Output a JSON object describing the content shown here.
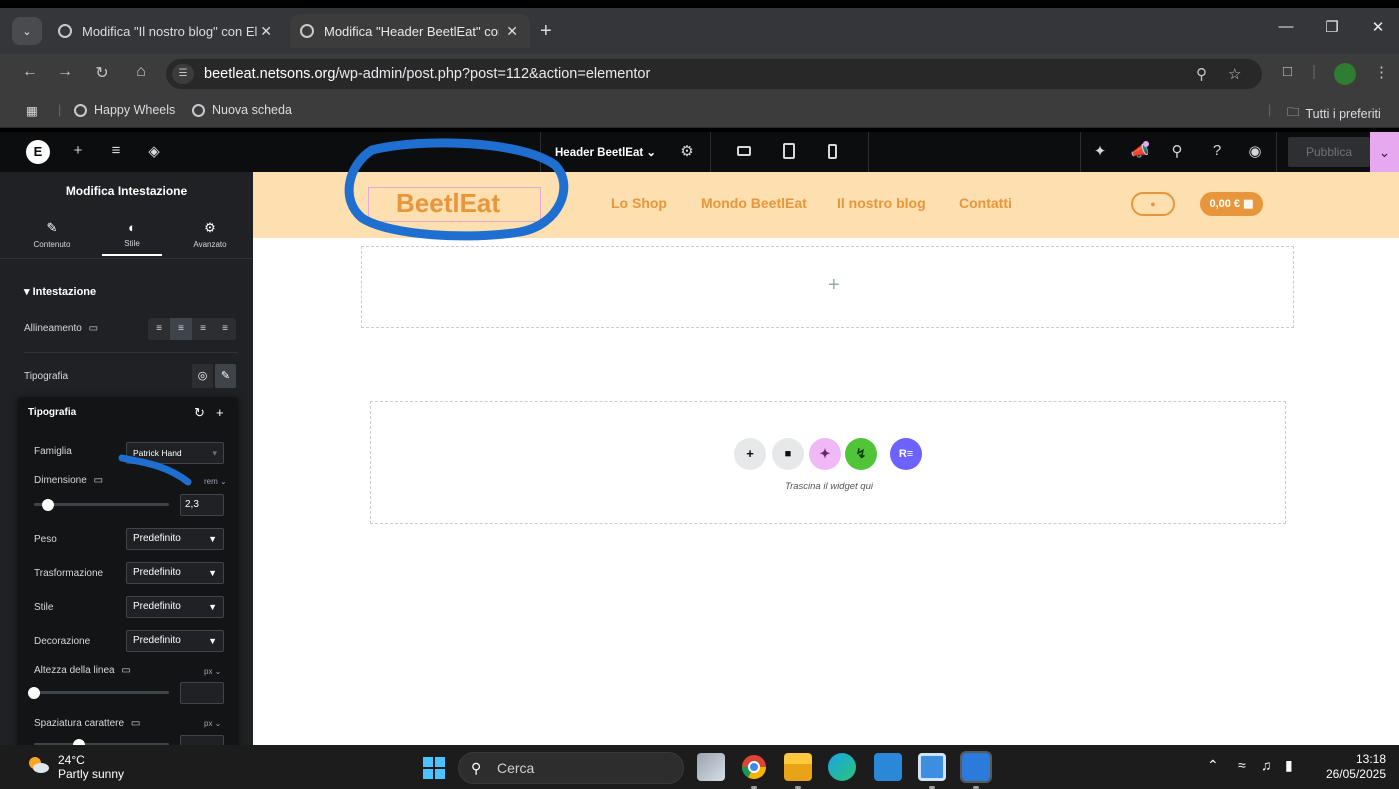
{
  "browser": {
    "tabs": [
      {
        "title": "Modifica \"Il nostro blog\" con El"
      },
      {
        "title": "Modifica \"Header BeetlEat\" con"
      }
    ],
    "url_host": "beetleat.netsons.org",
    "url_path": "/wp-admin/post.php?post=112&action=elementor",
    "bookmarks": [
      {
        "label": "Happy Wheels"
      },
      {
        "label": "Nuova scheda"
      }
    ],
    "all_bookmarks_label": "Tutti i preferiti"
  },
  "elementor_bar": {
    "document_title": "Header BeetlEat",
    "publish_label": "Pubblica",
    "accent_color": "#e8a8f0"
  },
  "panel": {
    "title": "Modifica Intestazione",
    "tabs": [
      {
        "label": "Contenuto",
        "icon": "pencil-icon"
      },
      {
        "label": "Stile",
        "icon": "contrast-icon"
      },
      {
        "label": "Avanzato",
        "icon": "gear-icon"
      }
    ],
    "section_title": "Intestazione",
    "alignment_label": "Allineamento",
    "typography_label": "Tipografia",
    "typography_popover": {
      "title": "Tipografia",
      "family_label": "Famiglia",
      "family_value": "Patrick Hand",
      "size_label": "Dimensione",
      "size_unit": "rem",
      "size_value": "2,3",
      "size_fraction": 0.1,
      "weight_label": "Peso",
      "weight_value": "Predefinito",
      "transform_label": "Trasformazione",
      "transform_value": "Predefinito",
      "style_label": "Stile",
      "style_value": "Predefinito",
      "decoration_label": "Decorazione",
      "decoration_value": "Predefinito",
      "line_height_label": "Altezza della linea",
      "line_height_unit": "px",
      "letter_spacing_label": "Spaziatura carattere",
      "letter_spacing_unit": "px"
    }
  },
  "canvas": {
    "logo_text": "BeetlEat",
    "nav": [
      {
        "label": "Lo Shop"
      },
      {
        "label": "Mondo BeetlEat"
      },
      {
        "label": "Il nostro blog"
      },
      {
        "label": "Contatti"
      }
    ],
    "cart_label": "0,00 €",
    "header_bg": "#fddfb0",
    "brand_color": "#e8963c",
    "drop_hint": "Trascina il widget qui",
    "add_section_symbol": "+"
  },
  "taskbar": {
    "temperature": "24°C",
    "weather": "Partly sunny",
    "search_placeholder": "Cerca",
    "time": "13:18",
    "date": "26/05/2025"
  }
}
